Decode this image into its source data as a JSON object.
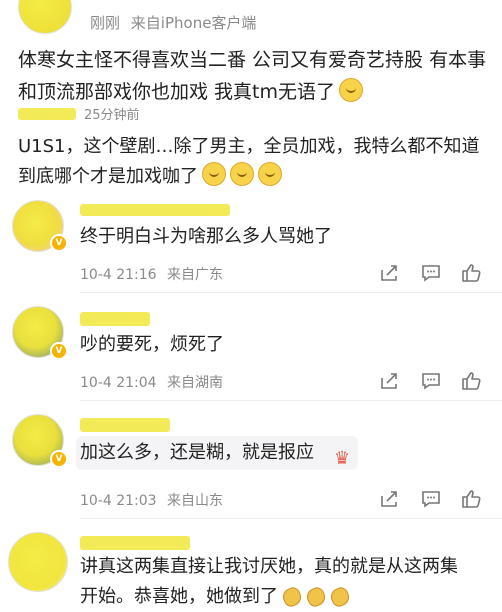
{
  "post": {
    "time": "刚刚",
    "source": "来自iPhone客户端",
    "text": "体寒女主怪不得喜欢当二番 公司又有爱奇艺持股 有本事和顶流那部戏你也加戏 我真tm无语了",
    "emoji": "smiling-emoji"
  },
  "quoted": {
    "time": "25分钟前",
    "text": "U1S1，这个壁剧…除了男主，全员加戏，我特么都不知道到底哪个才是加戏咖了",
    "emojis": [
      "grin-emoji",
      "grin-emoji",
      "grin-emoji"
    ]
  },
  "comments": [
    {
      "text": "终于明白斗为啥那么多人骂她了",
      "date": "10-4 21:16",
      "location": "来自广东"
    },
    {
      "text": "吵的要死，烦死了",
      "date": "10-4 21:04",
      "location": "来自湖南"
    },
    {
      "text": "加这么多，还是糊，就是报应",
      "date": "10-4 21:03",
      "location": "来自山东"
    },
    {
      "text_line1": "讲真这两集直接让我讨厌她，真的就是从这两集",
      "text_line2": "开始。恭喜她，她做到了"
    }
  ],
  "colors": {
    "redaction": "#f1e63a",
    "meta": "#8a8a8a",
    "badge": "#f4b400"
  }
}
